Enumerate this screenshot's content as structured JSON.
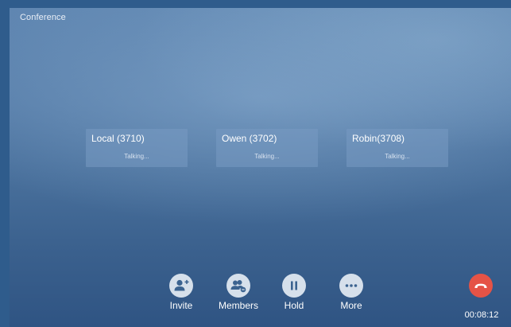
{
  "screen": {
    "title": "Conference"
  },
  "participants": [
    {
      "name": "Local (3710)",
      "status": "Talking..."
    },
    {
      "name": "Owen (3702)",
      "status": "Talking..."
    },
    {
      "name": "Robin(3708)",
      "status": "Talking..."
    }
  ],
  "controls": [
    {
      "label": "Invite",
      "icon": "add-user-icon"
    },
    {
      "label": "Members",
      "icon": "members-icon"
    },
    {
      "label": "Hold",
      "icon": "pause-icon"
    },
    {
      "label": "More",
      "icon": "more-icon"
    }
  ],
  "end_call": {
    "icon": "hang-up-icon",
    "color": "#e55346",
    "duration": "00:08:12"
  }
}
